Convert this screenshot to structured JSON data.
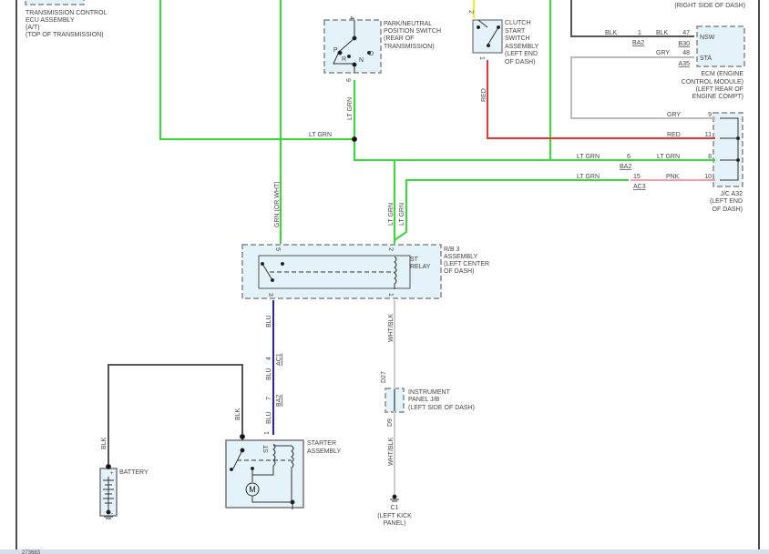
{
  "diagram_id": "273683",
  "colors": {
    "lt_grn": "#33dd33",
    "red": "#ee3333",
    "blu": "#2222cc",
    "yellow": "#eeee22",
    "blk": "#555555",
    "gry": "#bbbbbb",
    "pnk": "#ff99aa",
    "wht_blk": "#cccccc"
  },
  "components": {
    "tcu": {
      "lines": [
        "TRANSMISSION CONTROL",
        "ECU ASSEMBLY",
        "(A/T)",
        "(TOP OF TRANSMISSION)"
      ]
    },
    "pn_switch": {
      "lines": [
        "PARK/NEUTRAL",
        "POSITION SWITCH",
        "(REAR OF",
        "TRANSMISSION)"
      ],
      "pin_top": "4",
      "pin_bottom": "9",
      "positions": [
        "P",
        "R",
        "N",
        "D"
      ]
    },
    "clutch": {
      "lines": [
        "CLUTCH",
        "START",
        "SWITCH",
        "ASSEMBLY",
        "(LEFT END",
        "OF DASH)"
      ],
      "pin_top": "2",
      "pin_bottom": "1"
    },
    "top_right_note": "(RIGHT SIDE OF DASH)",
    "ecm": {
      "lines": [
        "ECM (ENGINE",
        "CONTROL MODULE)",
        "(LEFT REAR OF",
        "ENGINE COMPT)"
      ],
      "nsw": "NSW",
      "sta": "STA",
      "pin_nsw": "47",
      "conn_nsw": "B30",
      "pin_sta": "48",
      "conn_sta": "A35"
    },
    "jc": {
      "lines": [
        "J/C A32",
        "(LEFT END",
        "OF DASH)"
      ],
      "pins": [
        "9",
        "11",
        "8",
        "10"
      ]
    },
    "rb3": {
      "lines": [
        "R/B 3",
        "ASSEMBLY",
        "(LEFT CENTER",
        "OF DASH)"
      ],
      "relay": [
        "ST",
        "RELAY"
      ],
      "pins": [
        "5",
        "2",
        "3",
        "1"
      ]
    },
    "ipjb": {
      "lines": [
        "INSTRUMENT",
        "PANEL J/B",
        "(LEFT SIDE OF DASH)"
      ],
      "pin_top": "D27",
      "pin_bottom": "D9"
    },
    "ground": {
      "lines": [
        "C1",
        "(LEFT KICK",
        "PANEL)"
      ]
    },
    "starter": {
      "lines": [
        "STARTER",
        "ASSEMBLY"
      ],
      "st": "ST",
      "motor": "M",
      "pin": "1"
    },
    "battery": {
      "label": "BATTERY",
      "plus": "+",
      "minus": "-"
    }
  },
  "wires": {
    "blk1": "BLK",
    "blk2": "BLK",
    "ba2_pin": "1",
    "ba2": "BA2",
    "gry1": "GRY",
    "gry2": "GRY",
    "red_v": "RED",
    "red_h": "RED",
    "ltgrn_left": "LT GRN",
    "ltgrn_pn": "LT GRN",
    "ltgrn_a": "LT GRN",
    "ltgrn_b": "LT GRN",
    "ba2_6": "6",
    "ba2_6_conn": "BA2",
    "ltgrn_c": "LT GRN",
    "pnk": "PNK",
    "ac3_pin": "15",
    "ac3": "AC3",
    "grn_or_wht": "GRN (OR WHT)",
    "relay_ltgrn1": "LT GRN",
    "relay_ltgrn2": "LT GRN",
    "blu1": "BLU",
    "ac1_pin": "4",
    "ac1": "AC1",
    "blu2": "BLU",
    "ba2_7": "7",
    "ba2_7_conn": "BA2",
    "wht_blk1": "WHT/BLK",
    "wht_blk2": "WHT/BLK",
    "blk_starter": "BLK",
    "blk_batt": "BLK"
  }
}
